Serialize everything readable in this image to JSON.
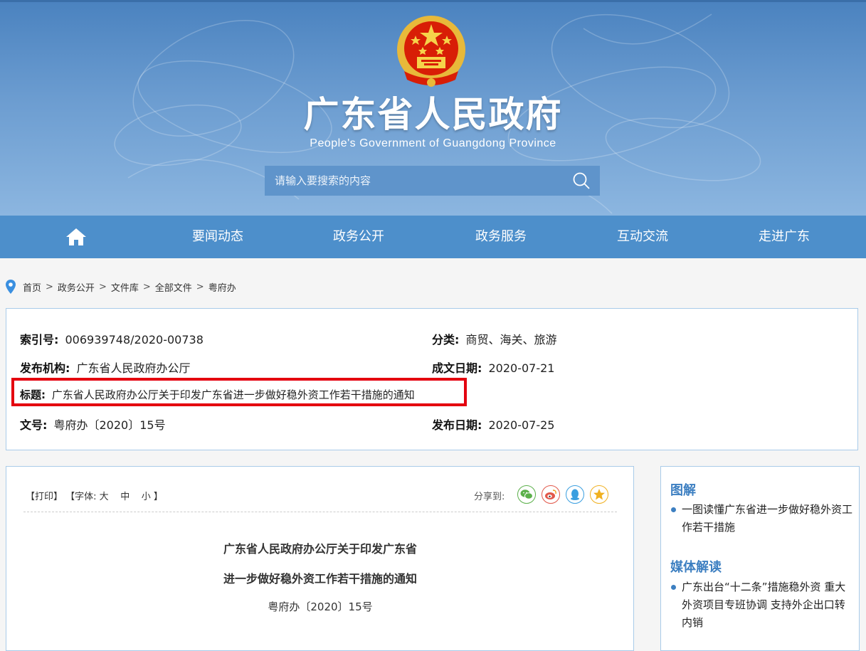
{
  "header": {
    "title": "广东省人民政府",
    "subtitle": "People's Government of Guangdong Province",
    "search_placeholder": "请输入要搜索的内容"
  },
  "nav": {
    "home_icon": "home-icon",
    "items": [
      "要闻动态",
      "政务公开",
      "政务服务",
      "互动交流",
      "走进广东"
    ]
  },
  "breadcrumb": [
    "首页",
    "政务公开",
    "文件库",
    "全部文件",
    "粤府办"
  ],
  "info": {
    "index_label": "索引号:",
    "index_value": "006939748/2020-00738",
    "category_label": "分类:",
    "category_value": "商贸、海关、旅游",
    "publisher_label": "发布机构:",
    "publisher_value": "广东省人民政府办公厅",
    "created_label": "成文日期:",
    "created_value": "2020-07-21",
    "title_label": "标题:",
    "title_value": "广东省人民政府办公厅关于印发广东省进一步做好稳外资工作若干措施的通知",
    "docno_label": "文号:",
    "docno_value": "粤府办〔2020〕15号",
    "published_label": "发布日期:",
    "published_value": "2020-07-25"
  },
  "tools": {
    "print": "【打印】",
    "font_prefix": "【字体: ",
    "font_large": "大",
    "font_medium": "中",
    "font_small": "小",
    "font_suffix": " 】",
    "share_label": "分享到:"
  },
  "document": {
    "title_line1": "广东省人民政府办公厅关于印发广东省",
    "title_line2": "进一步做好稳外资工作若干措施的通知",
    "doc_number": "粤府办〔2020〕15号"
  },
  "sidebar": {
    "section1_heading": "图解",
    "section1_item": "一图读懂广东省进一步做好稳外资工作若干措施",
    "section2_heading": "媒体解读",
    "section2_item": "广东出台“十二条”措施稳外资 重大外资项目专班协调 支持外企出口转内销"
  },
  "colors": {
    "nav_bg": "#4d8fcb",
    "accent_blue": "#3d7fc1",
    "highlight_red": "#e4000f",
    "wechat_green": "#5bb04a",
    "weibo_red": "#e2584a",
    "qq_blue": "#3a9fe0",
    "qzone_orange": "#f0b020"
  }
}
